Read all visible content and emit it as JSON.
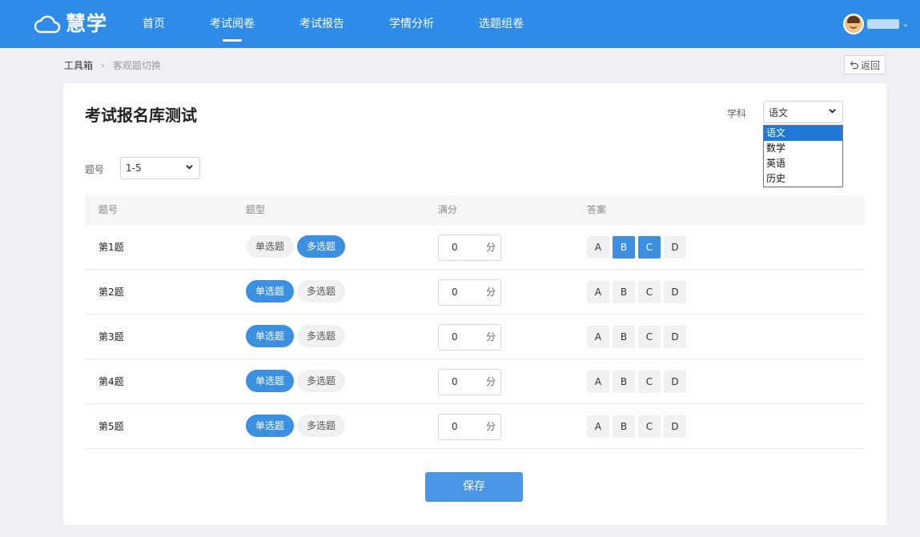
{
  "app": {
    "logo_text": "慧学",
    "nav": [
      {
        "label": "首页",
        "active": false
      },
      {
        "label": "考试阅卷",
        "active": true
      },
      {
        "label": "考试报告",
        "active": false
      },
      {
        "label": "学情分析",
        "active": false
      },
      {
        "label": "选题组卷",
        "active": false
      }
    ]
  },
  "breadcrumb": {
    "root": "工具箱",
    "separator": "›",
    "current": "客观题切换"
  },
  "back_button": {
    "icon": "undo-arrow-icon",
    "label": "返回"
  },
  "page": {
    "title": "考试报名库测试",
    "subject_label": "学科",
    "subject_selected": "语文",
    "subject_options": [
      "语文",
      "数学",
      "英语",
      "历史"
    ],
    "qno_label": "题号",
    "qno_selected": "1-5"
  },
  "table": {
    "headers": [
      "题号",
      "题型",
      "满分",
      "答案"
    ],
    "type_options": [
      "单选题",
      "多选题"
    ],
    "answer_options": [
      "A",
      "B",
      "C",
      "D"
    ],
    "score_unit": "分",
    "rows": [
      {
        "question": "第1题",
        "type": "多选题",
        "score": "0",
        "answers": [
          "B",
          "C"
        ]
      },
      {
        "question": "第2题",
        "type": "单选题",
        "score": "0",
        "answers": []
      },
      {
        "question": "第3题",
        "type": "单选题",
        "score": "0",
        "answers": []
      },
      {
        "question": "第4题",
        "type": "单选题",
        "score": "0",
        "answers": []
      },
      {
        "question": "第5题",
        "type": "单选题",
        "score": "0",
        "answers": []
      }
    ]
  },
  "save_label": "保存",
  "colors": {
    "primary": "#2f8be8",
    "selected": "#3d8fe0"
  }
}
